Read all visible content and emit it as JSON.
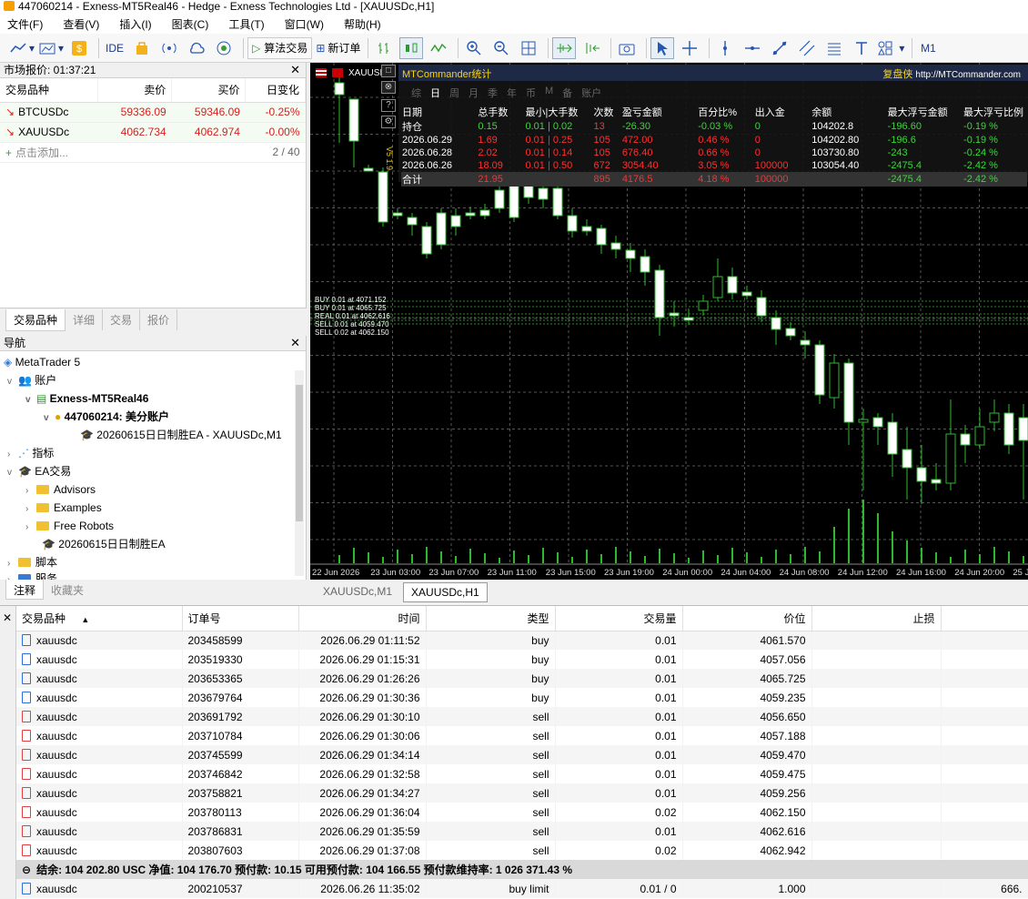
{
  "window": {
    "title": "447060214 - Exness-MT5Real46 - Hedge - Exness Technologies Ltd - [XAUUSDc,H1]"
  },
  "menu": [
    "文件(F)",
    "查看(V)",
    "插入(I)",
    "图表(C)",
    "工具(T)",
    "窗口(W)",
    "帮助(H)"
  ],
  "toolbar": {
    "ide": "IDE",
    "algo": "算法交易",
    "new_order": "新订单",
    "m1": "M1"
  },
  "market_watch": {
    "title": "市场报价: 01:37:21",
    "headers": [
      "交易品种",
      "卖价",
      "买价",
      "日变化"
    ],
    "rows": [
      {
        "symbol": "BTCUSDc",
        "bid": "59336.09",
        "ask": "59346.09",
        "change": "-0.25%"
      },
      {
        "symbol": "XAUUSDc",
        "bid": "4062.734",
        "ask": "4062.974",
        "change": "-0.00%"
      }
    ],
    "add": "点击添加...",
    "count": "2 / 40",
    "tabs": [
      "交易品种",
      "详细",
      "交易",
      "报价"
    ]
  },
  "navigator": {
    "title": "导航",
    "items": {
      "mt5": "MetaTrader 5",
      "accounts": "账户",
      "server": "Exness-MT5Real46",
      "account": "447060214: 美分账户",
      "ea_attached": "20260615日日制胜EA - XAUUSDc,M1",
      "indicators": "指标",
      "ea": "EA交易",
      "advisors": "Advisors",
      "examples": "Examples",
      "free_robots": "Free Robots",
      "ea_file": "20260615日日制胜EA",
      "scripts": "脚本",
      "services": "服务"
    },
    "tabs": [
      "注释",
      "收藏夹"
    ]
  },
  "chart": {
    "symbol": "XAUUSDc",
    "mtc": {
      "title": "MTCommander统计",
      "link_label": "复盘侠",
      "link_url": "http://MTCommander.com",
      "periods": [
        "综",
        "日",
        "周",
        "月",
        "季",
        "年",
        "币",
        "M",
        "备",
        "账户"
      ],
      "headers": [
        "日期",
        "总手数",
        "最小|大手数",
        "次数",
        "盈亏金额",
        "百分比%",
        "出入金",
        "余额",
        "最大浮亏金额",
        "最大浮亏比例"
      ],
      "rows": [
        [
          "持仓",
          "0.15",
          "0.01 | 0.02",
          "13",
          "-26.30",
          "-0.03 %",
          "0",
          "104202.8",
          "-196.60",
          "-0.19 %"
        ],
        [
          "2026.06.29",
          "1.69",
          "0.01 | 0.25",
          "105",
          "472.00",
          "0.46 %",
          "0",
          "104202.80",
          "-196.6",
          "-0.19 %"
        ],
        [
          "2026.06.28",
          "2.02",
          "0.01 | 0.14",
          "105",
          "676.40",
          "0.66 %",
          "0",
          "103730.80",
          "-243",
          "-0.24 %"
        ],
        [
          "2026.06.26",
          "18.09",
          "0.01 | 0.50",
          "672",
          "3054.40",
          "3.05 %",
          "100000",
          "103054.40",
          "-2475.4",
          "-2.42 %"
        ],
        [
          "合计",
          "21.95",
          "",
          "895",
          "4176.5",
          "4.18 %",
          "100000",
          "",
          "-2475.4",
          "-2.42 %"
        ]
      ]
    },
    "order_labels": [
      "BUY 0.01 at 4071.152",
      "BUY 0.01 at 4065.725",
      "REAL 0.01 at 4062.616",
      "SELL 0.01 at 4059.470",
      "SELL 0.02 at 4062.150"
    ],
    "side_label": "V5 1.9",
    "x_labels": [
      "22 Jun 2026",
      "23 Jun 03:00",
      "23 Jun 07:00",
      "23 Jun 11:00",
      "23 Jun 15:00",
      "23 Jun 19:00",
      "24 Jun 00:00",
      "24 Jun 04:00",
      "24 Jun 08:00",
      "24 Jun 12:00",
      "24 Jun 16:00",
      "24 Jun 20:00",
      "25 Jun"
    ],
    "tabs": [
      "XAUUSDc,M1",
      "XAUUSDc,H1"
    ]
  },
  "trade": {
    "headers": [
      "交易品种",
      "订单号",
      "时间",
      "类型",
      "交易量",
      "价位",
      "止损"
    ],
    "rows": [
      {
        "symbol": "xauusdc",
        "order": "203458599",
        "time": "2026.06.29 01:11:52",
        "type": "buy",
        "volume": "0.01",
        "price": "4061.570"
      },
      {
        "symbol": "xauusdc",
        "order": "203519330",
        "time": "2026.06.29 01:15:31",
        "type": "buy",
        "volume": "0.01",
        "price": "4057.056"
      },
      {
        "symbol": "xauusdc",
        "order": "203653365",
        "time": "2026.06.29 01:26:26",
        "type": "buy",
        "volume": "0.01",
        "price": "4065.725"
      },
      {
        "symbol": "xauusdc",
        "order": "203679764",
        "time": "2026.06.29 01:30:36",
        "type": "buy",
        "volume": "0.01",
        "price": "4059.235"
      },
      {
        "symbol": "xauusdc",
        "order": "203691792",
        "time": "2026.06.29 01:30:10",
        "type": "sell",
        "volume": "0.01",
        "price": "4056.650"
      },
      {
        "symbol": "xauusdc",
        "order": "203710784",
        "time": "2026.06.29 01:30:06",
        "type": "sell",
        "volume": "0.01",
        "price": "4057.188"
      },
      {
        "symbol": "xauusdc",
        "order": "203745599",
        "time": "2026.06.29 01:34:14",
        "type": "sell",
        "volume": "0.01",
        "price": "4059.470"
      },
      {
        "symbol": "xauusdc",
        "order": "203746842",
        "time": "2026.06.29 01:32:58",
        "type": "sell",
        "volume": "0.01",
        "price": "4059.475"
      },
      {
        "symbol": "xauusdc",
        "order": "203758821",
        "time": "2026.06.29 01:34:27",
        "type": "sell",
        "volume": "0.01",
        "price": "4059.256"
      },
      {
        "symbol": "xauusdc",
        "order": "203780113",
        "time": "2026.06.29 01:36:04",
        "type": "sell",
        "volume": "0.02",
        "price": "4062.150"
      },
      {
        "symbol": "xauusdc",
        "order": "203786831",
        "time": "2026.06.29 01:35:59",
        "type": "sell",
        "volume": "0.01",
        "price": "4062.616"
      },
      {
        "symbol": "xauusdc",
        "order": "203807603",
        "time": "2026.06.29 01:37:08",
        "type": "sell",
        "volume": "0.02",
        "price": "4062.942"
      }
    ],
    "summary": "结余: 104 202.80 USC  净值: 104 176.70  预付款: 10.15  可用预付款: 104 166.55  预付款维持率: 1 026 371.43 %",
    "pending": {
      "symbol": "xauusdc",
      "order": "200210537",
      "time": "2026.06.26 11:35:02",
      "type": "buy limit",
      "volume": "0.01 / 0",
      "price": "1.000",
      "last": "666."
    }
  }
}
